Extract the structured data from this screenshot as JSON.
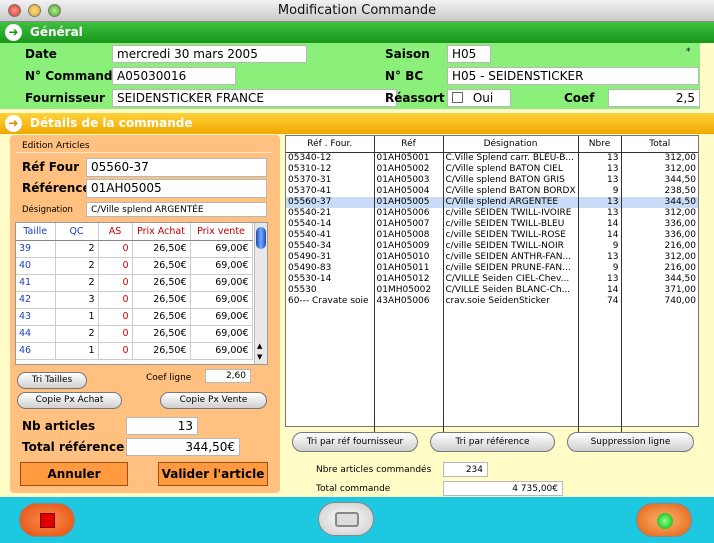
{
  "window": {
    "title": "Modification Commande"
  },
  "general": {
    "title": "Général",
    "date_label": "Date",
    "date_value": "mercredi 30 mars 2005",
    "saison_label": "Saison",
    "saison_value": "H05",
    "asterisk": "*",
    "commande_label": "N° Commande",
    "commande_value": "A05030016",
    "bc_label": "N° BC",
    "bc_value": "H05 - SEIDENSTICKER",
    "fournisseur_label": "Fournisseur",
    "fournisseur_value": "SEIDENSTICKER FRANCE",
    "reassort_label": "Réassort",
    "reassort_option": "Oui",
    "coef_label": "Coef",
    "coef_value": "2,5"
  },
  "details": {
    "title": "Détails de la commande"
  },
  "edition": {
    "title": "Edition Articles",
    "ref_four_label": "Réf Four",
    "ref_four_value": "05560-37",
    "reference_label": "Référence",
    "reference_value": "01AH05005",
    "designation_label": "Désignation",
    "designation_value": "C/Ville splend ARGENTÉE",
    "sizes": {
      "columns": [
        "Taille",
        "QC",
        "AS",
        "Prix Achat",
        "Prix vente"
      ],
      "rows": [
        [
          "39",
          "2",
          "0",
          "26,50€",
          "69,00€"
        ],
        [
          "40",
          "2",
          "0",
          "26,50€",
          "69,00€"
        ],
        [
          "41",
          "2",
          "0",
          "26,50€",
          "69,00€"
        ],
        [
          "42",
          "3",
          "0",
          "26,50€",
          "69,00€"
        ],
        [
          "43",
          "1",
          "0",
          "26,50€",
          "69,00€"
        ],
        [
          "44",
          "2",
          "0",
          "26,50€",
          "69,00€"
        ],
        [
          "46",
          "1",
          "0",
          "26,50€",
          "69,00€"
        ]
      ]
    },
    "tri_tailles": "Tri Tailles",
    "coef_ligne_label": "Coef ligne",
    "coef_ligne_value": "2,60",
    "copie_achat": "Copie Px Achat",
    "copie_vente": "Copie Px Vente",
    "nb_articles_label": "Nb articles",
    "nb_articles_value": "13",
    "total_ref_label": "Total référence",
    "total_ref_value": "344,50€",
    "annuler": "Annuler",
    "valider": "Valider l'article"
  },
  "orders": {
    "columns": [
      "Réf . Four.",
      "Réf",
      "Désignation",
      "Nbre",
      "Total"
    ],
    "rows": [
      [
        "05340-12",
        "01AH05001",
        "C.Ville Splend carr. BLEU-B...",
        "13",
        "312,00"
      ],
      [
        "05310-12",
        "01AH05002",
        "C/Ville splend BATON CIEL",
        "13",
        "312,00"
      ],
      [
        "05370-31",
        "01AH05003",
        "C/Ville splend BATON GRIS",
        "13",
        "344,50"
      ],
      [
        "05370-41",
        "01AH05004",
        "C/Ville splend BATON BORDX",
        "9",
        "238,50"
      ],
      [
        "05560-37",
        "01AH05005",
        "C/Ville splend ARGENTÉE",
        "13",
        "344,50"
      ],
      [
        "05540-21",
        "01AH05006",
        "c/ville SEIDEN TWILL-IVOIRE",
        "13",
        "312,00"
      ],
      [
        "05540-14",
        "01AH05007",
        "c/ville SEIDEN TWILL-BLEU",
        "14",
        "336,00"
      ],
      [
        "05540-41",
        "01AH05008",
        "c/ville SEIDEN TWILL-ROSE",
        "14",
        "336,00"
      ],
      [
        "05540-34",
        "01AH05009",
        "c/ville SEIDEN TWILL-NOIR",
        "9",
        "216,00"
      ],
      [
        "05490-31",
        "01AH05010",
        "c/ville SEIDEN ANTHR-FAN...",
        "13",
        "312,00"
      ],
      [
        "05490-83",
        "01AH05011",
        "c/ville SEIDEN PRUNE-FAN...",
        "9",
        "216,00"
      ],
      [
        "05530-14",
        "01AH05012",
        "C/VILLE Seiden CIEL-Chev...",
        "13",
        "344,50"
      ],
      [
        "05530",
        "01MH05002",
        "C/VILLE Seiden BLANC-Ch...",
        "14",
        "371,00"
      ],
      [
        "60--- Cravate soie",
        "43AH05006",
        "crav.soie SeidenSticker",
        "74",
        "740,00"
      ]
    ],
    "selected_index": 4,
    "tri_ref_four": "Tri par réf fournisseur",
    "tri_ref": "Tri par référence",
    "suppression": "Suppression ligne",
    "nbre_label": "Nbre articles commandés",
    "nbre_value": "234",
    "total_label": "Total commande",
    "total_value": "4 735,00€"
  }
}
